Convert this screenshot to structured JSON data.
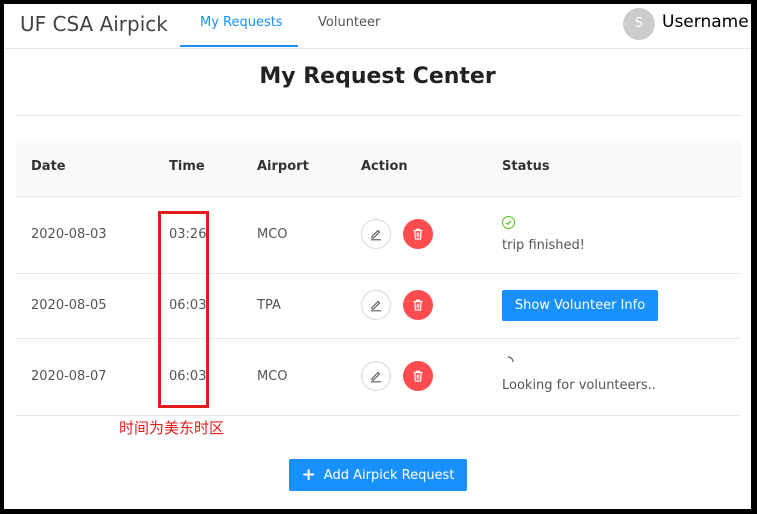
{
  "header": {
    "brand": "UF CSA Airpick",
    "tabs": [
      {
        "label": "My Requests",
        "active": true
      },
      {
        "label": "Volunteer",
        "active": false
      }
    ],
    "user": {
      "avatar_initial": "S",
      "name": "Username"
    }
  },
  "page_title": "My Request Center",
  "table": {
    "columns": [
      "Date",
      "Time",
      "Airport",
      "Action",
      "Status"
    ],
    "rows": [
      {
        "date": "2020-08-03",
        "time": "03:26",
        "airport": "MCO",
        "status_type": "finished",
        "status_text": "trip finished!",
        "status_icon": "check-circle-icon"
      },
      {
        "date": "2020-08-05",
        "time": "06:03",
        "airport": "TPA",
        "status_type": "button",
        "status_text": "Show Volunteer Info"
      },
      {
        "date": "2020-08-07",
        "time": "06:03",
        "airport": "MCO",
        "status_type": "loading",
        "status_text": "Looking for volunteers..",
        "status_icon": "loading-spinner-icon"
      }
    ]
  },
  "annotation": "时间为美东时区",
  "add_button": {
    "label": "Add Airpick Request",
    "icon": "plus-icon"
  },
  "colors": {
    "primary": "#1890ff",
    "danger": "#ff4d4f",
    "success": "#52c41a",
    "highlight": "#e31b1b"
  }
}
